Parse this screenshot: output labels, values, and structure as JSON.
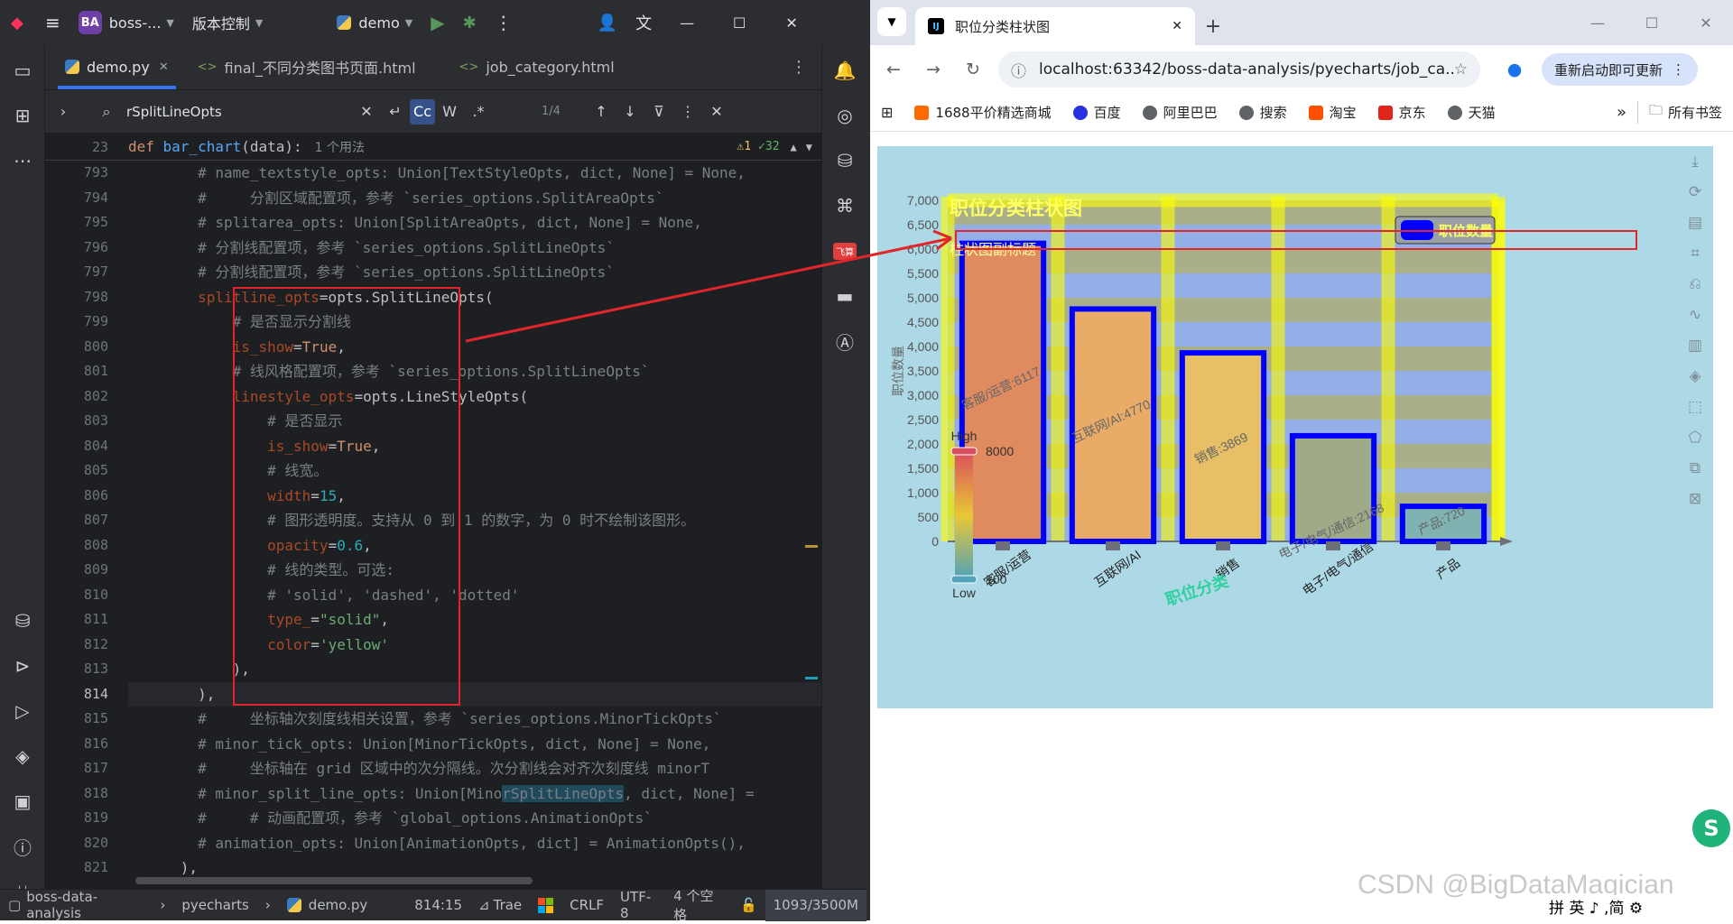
{
  "ide": {
    "project_badge": "BA",
    "project_name": "boss-...",
    "vcs_menu": "版本控制",
    "run_config": "demo",
    "tabs": [
      {
        "label": "demo.py",
        "active": true
      },
      {
        "label": "final_不同分类图书页面.html",
        "active": false
      },
      {
        "label": "job_category.html",
        "active": false
      }
    ],
    "find": {
      "query": "rSplitLineOpts",
      "cc_label": "Cc",
      "w_label": "W",
      "regex_label": ".*",
      "count": "1/4"
    },
    "sticky": {
      "line": "23",
      "text_def": "def ",
      "text_fn": "bar_chart",
      "text_args": "(data):",
      "usage": "1 个用法",
      "warnings": "⚠1",
      "checks": "✓32"
    },
    "line_numbers": [
      "793",
      "794",
      "795",
      "796",
      "797",
      "798",
      "799",
      "800",
      "801",
      "802",
      "803",
      "804",
      "805",
      "806",
      "807",
      "808",
      "809",
      "810",
      "811",
      "812",
      "813",
      "814",
      "815",
      "816",
      "817",
      "818",
      "819",
      "820",
      "821"
    ],
    "code_lines": [
      {
        "indent": "        ",
        "segs": [
          {
            "c": "cm",
            "t": "# name_textstyle_opts: Union[TextStyleOpts, dict, None] = None,"
          }
        ]
      },
      {
        "indent": "        ",
        "segs": [
          {
            "c": "cm",
            "t": "#     分割区域配置项，参考 `series_options.SplitAreaOpts`"
          }
        ]
      },
      {
        "indent": "        ",
        "segs": [
          {
            "c": "cm",
            "t": "# splitarea_opts: Union[SplitAreaOpts, dict, None] = None,"
          }
        ]
      },
      {
        "indent": "        ",
        "segs": [
          {
            "c": "cm",
            "t": "# 分割线配置项，参考 `series_options.SplitLineOpts`"
          }
        ]
      },
      {
        "indent": "        ",
        "segs": [
          {
            "c": "cm",
            "t": "# 分割线配置项，参考 `series_options.SplitLineOpts`"
          }
        ]
      },
      {
        "indent": "        ",
        "segs": [
          {
            "c": "pn",
            "t": "splitline_opts"
          },
          {
            "c": "",
            "t": "=opts.SplitLineOpts("
          }
        ]
      },
      {
        "indent": "            ",
        "segs": [
          {
            "c": "cm",
            "t": "# 是否显示分割线"
          }
        ]
      },
      {
        "indent": "            ",
        "segs": [
          {
            "c": "pn",
            "t": "is_show"
          },
          {
            "c": "",
            "t": "="
          },
          {
            "c": "kw",
            "t": "True"
          },
          {
            "c": "",
            "t": ","
          }
        ]
      },
      {
        "indent": "            ",
        "segs": [
          {
            "c": "cm",
            "t": "# 线风格配置项，参考 `series_options.SplitLineOpts`"
          }
        ]
      },
      {
        "indent": "            ",
        "segs": [
          {
            "c": "pn",
            "t": "linestyle_opts"
          },
          {
            "c": "",
            "t": "=opts.LineStyleOpts("
          }
        ]
      },
      {
        "indent": "                ",
        "segs": [
          {
            "c": "cm",
            "t": "# 是否显示"
          }
        ]
      },
      {
        "indent": "                ",
        "segs": [
          {
            "c": "pn",
            "t": "is_show"
          },
          {
            "c": "",
            "t": "="
          },
          {
            "c": "kw",
            "t": "True"
          },
          {
            "c": "",
            "t": ","
          }
        ]
      },
      {
        "indent": "                ",
        "segs": [
          {
            "c": "cm",
            "t": "# 线宽。"
          }
        ]
      },
      {
        "indent": "                ",
        "segs": [
          {
            "c": "pn",
            "t": "width"
          },
          {
            "c": "",
            "t": "="
          },
          {
            "c": "nu",
            "t": "15"
          },
          {
            "c": "",
            "t": ","
          }
        ]
      },
      {
        "indent": "                ",
        "segs": [
          {
            "c": "cm",
            "t": "# 图形透明度。支持从 0 到 1 的数字，为 0 时不绘制该图形。"
          }
        ]
      },
      {
        "indent": "                ",
        "segs": [
          {
            "c": "pn",
            "t": "opacity"
          },
          {
            "c": "",
            "t": "="
          },
          {
            "c": "nu",
            "t": "0.6"
          },
          {
            "c": "",
            "t": ","
          }
        ]
      },
      {
        "indent": "                ",
        "segs": [
          {
            "c": "cm",
            "t": "# 线的类型。可选:"
          }
        ]
      },
      {
        "indent": "                ",
        "segs": [
          {
            "c": "cm",
            "t": "# 'solid', 'dashed', 'dotted'"
          }
        ]
      },
      {
        "indent": "                ",
        "segs": [
          {
            "c": "pn",
            "t": "type_"
          },
          {
            "c": "",
            "t": "="
          },
          {
            "c": "st",
            "t": "\"solid\""
          },
          {
            "c": "",
            "t": ","
          }
        ]
      },
      {
        "indent": "                ",
        "segs": [
          {
            "c": "pn",
            "t": "color"
          },
          {
            "c": "",
            "t": "="
          },
          {
            "c": "st",
            "t": "'yellow'"
          }
        ]
      },
      {
        "indent": "            ",
        "segs": [
          {
            "c": "",
            "t": "),"
          }
        ]
      },
      {
        "indent": "        ",
        "segs": [
          {
            "c": "",
            "t": "),"
          }
        ]
      },
      {
        "indent": "        ",
        "segs": [
          {
            "c": "cm",
            "t": "#     坐标轴次刻度线相关设置，参考 `series_options.MinorTickOpts`"
          }
        ]
      },
      {
        "indent": "        ",
        "segs": [
          {
            "c": "cm",
            "t": "# minor_tick_opts: Union[MinorTickOpts, dict, None] = None,"
          }
        ]
      },
      {
        "indent": "        ",
        "segs": [
          {
            "c": "cm",
            "t": "#     坐标轴在 grid 区域中的次分隔线。次分割线会对齐次刻度线 minorT"
          }
        ]
      },
      {
        "indent": "        ",
        "segs": [
          {
            "c": "cm",
            "t": "# minor_split_line_opts: Union[Mino"
          },
          {
            "c": "cm hl",
            "t": "rSplitLineOpts"
          },
          {
            "c": "cm",
            "t": ", dict, None] ="
          }
        ]
      },
      {
        "indent": "        ",
        "segs": [
          {
            "c": "cm",
            "t": "#     # 动画配置项，参考 `global_options.AnimationOpts`"
          }
        ]
      },
      {
        "indent": "        ",
        "segs": [
          {
            "c": "cm",
            "t": "# animation_opts: Union[AnimationOpts, dict] = AnimationOpts(),"
          }
        ]
      },
      {
        "indent": "      ",
        "segs": [
          {
            "c": "",
            "t": "),"
          }
        ]
      }
    ],
    "current_line_index": 21,
    "status": {
      "project": "boss-data-analysis",
      "folder": "pyecharts",
      "file": "demo.py",
      "position": "814:15",
      "plugin": "Trae",
      "line_sep": "CRLF",
      "encoding": "UTF-8",
      "indent": "4 个空格",
      "memory": "1093/3500M"
    }
  },
  "browser": {
    "tab_title": "职位分类柱状图",
    "url": "localhost:63342/boss-data-analysis/pyecharts/job_ca...",
    "restart_label": "重新启动即可更新",
    "bookmarks": [
      "1688平价精选商城",
      "百度",
      "阿里巴巴",
      "搜索",
      "淘宝",
      "京东",
      "天猫"
    ],
    "bookmarks_more": "»",
    "all_bookmarks": "所有书签"
  },
  "chart_data": {
    "type": "bar",
    "title": "职位分类柱状图",
    "subtitle": "柱状图副标题",
    "xlabel": "职位分类",
    "ylabel": "职位数量",
    "legend": {
      "label": "职位数量",
      "position": "top-right"
    },
    "categories": [
      "客服/运营",
      "互联网/AI",
      "销售",
      "电子/电气/通信",
      "产品"
    ],
    "values": [
      6117,
      4770,
      3869,
      2168,
      720
    ],
    "data_labels": [
      "客服/运营:6117",
      "互联网/AI:4770",
      "销售:3869",
      "电子/电气/通信:2168",
      "产品:720"
    ],
    "ylim": [
      0,
      7000
    ],
    "yticks": [
      "0",
      "500",
      "1,000",
      "1,500",
      "2,000",
      "2,500",
      "3,000",
      "3,500",
      "4,000",
      "4,500",
      "5,000",
      "5,500",
      "6,000",
      "6,500",
      "7,000"
    ],
    "grid": true,
    "visualmap": {
      "high": "High",
      "low": "Low",
      "max_value": "8000",
      "min_value": "100"
    },
    "colors": {
      "bar_border": "#0000ff",
      "splitline": "#ffff00",
      "background": "#add8e6",
      "splitarea_a": "#a8a878",
      "splitarea_b": "#8fa8e8"
    }
  },
  "footer": {
    "watermark": "CSDN @BigDataMagician",
    "ime": "拼 英 ♪ ,简 ⚙"
  }
}
